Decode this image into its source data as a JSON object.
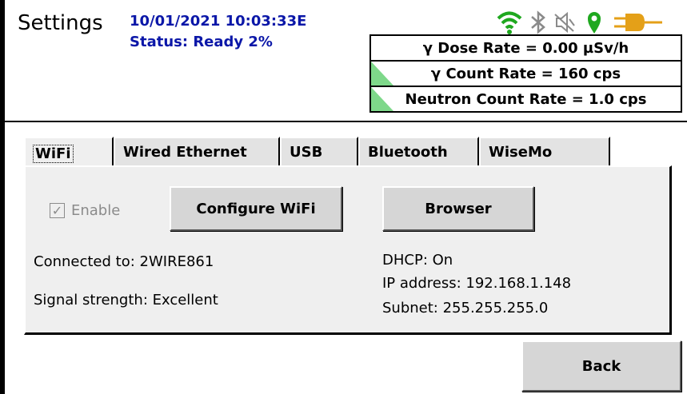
{
  "header": {
    "title": "Settings",
    "datetime": "10/01/2021 10:03:33E",
    "status": "Status: Ready 2%"
  },
  "status_icons": [
    {
      "name": "wifi-icon",
      "color": "#1fa81f"
    },
    {
      "name": "bluetooth-icon",
      "color": "#8a8a8a"
    },
    {
      "name": "sound-muted-icon",
      "color": "#8a8a8a"
    },
    {
      "name": "gps-icon",
      "color": "#1fa81f"
    },
    {
      "name": "power-plug-icon",
      "color": "#e4a018"
    }
  ],
  "rates": {
    "gamma_dose": "γ Dose Rate = 0.00  µSv/h",
    "gamma_count": "γ Count Rate = 160 cps",
    "neutron_count": "Neutron Count Rate = 1.0 cps"
  },
  "tabs": [
    {
      "label": "WiFi",
      "active": true
    },
    {
      "label": "Wired Ethernet",
      "active": false
    },
    {
      "label": "USB",
      "active": false
    },
    {
      "label": "Bluetooth",
      "active": false
    },
    {
      "label": "WiseMo",
      "active": false
    }
  ],
  "wifi": {
    "enable_label": "Enable",
    "enable_checked": true,
    "configure_label": "Configure WiFi",
    "browser_label": "Browser",
    "connected_to": "Connected to: 2WIRE861",
    "signal_strength": "Signal strength: Excellent",
    "dhcp": "DHCP: On",
    "ip_address": "IP address: 192.168.1.148",
    "subnet": "Subnet: 255.255.255.0"
  },
  "footer": {
    "back_label": "Back"
  },
  "colors": {
    "accent_text": "#0b17a8",
    "indicator_green": "#7ed88a"
  }
}
